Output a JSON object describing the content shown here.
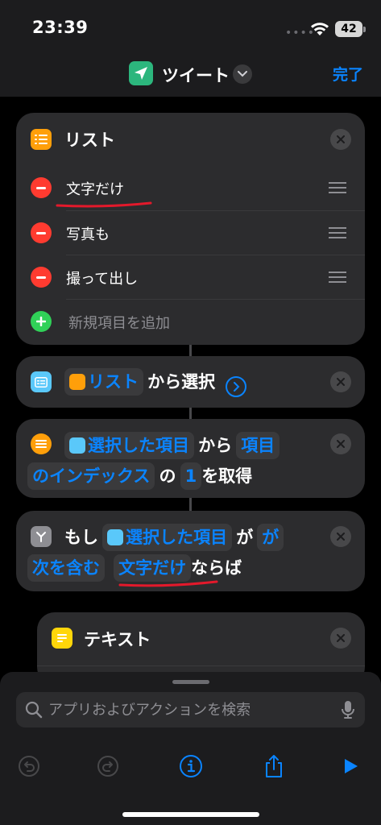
{
  "status": {
    "time": "23:39",
    "battery": "42"
  },
  "nav": {
    "title": "ツイート",
    "done": "完了",
    "app_icon_color": "#2cb67d"
  },
  "list_action": {
    "title": "リスト",
    "items": [
      "文字だけ",
      "写真も",
      "撮って出し"
    ],
    "add_placeholder": "新規項目を追加"
  },
  "choose_action": {
    "token": "リスト",
    "text": "から選択"
  },
  "get_item_action": {
    "token_selected": "選択した項目",
    "from": "から",
    "token_item_a": "項目",
    "token_item_b": "のインデックス",
    "of": "の",
    "index": "1",
    "get": "を取得"
  },
  "if_action": {
    "if": "もし",
    "token_selected": "選択した項目",
    "ga": "が",
    "token_cond_a": "が",
    "token_cond_b": "次を含む",
    "token_value": "文字だけ",
    "then": "ならば"
  },
  "text_action": {
    "title": "テキスト"
  },
  "search": {
    "placeholder": "アプリおよびアクションを検索"
  },
  "colors": {
    "accent": "#0a84ff",
    "red": "#ff3b30",
    "green": "#30d158",
    "list_icon": "#ff9f0a",
    "choose_icon": "#5ac8fa",
    "if_icon": "#8e8e93",
    "text_icon": "#ffd60a",
    "annotation": "#e3192b"
  },
  "icons": [
    "send-icon",
    "chevron-down-icon",
    "list-icon",
    "close-icon",
    "drag-handle-icon",
    "choose-icon",
    "if-icon",
    "text-icon",
    "search-icon",
    "mic-icon",
    "undo-icon",
    "redo-icon",
    "info-icon",
    "share-icon",
    "play-icon"
  ]
}
